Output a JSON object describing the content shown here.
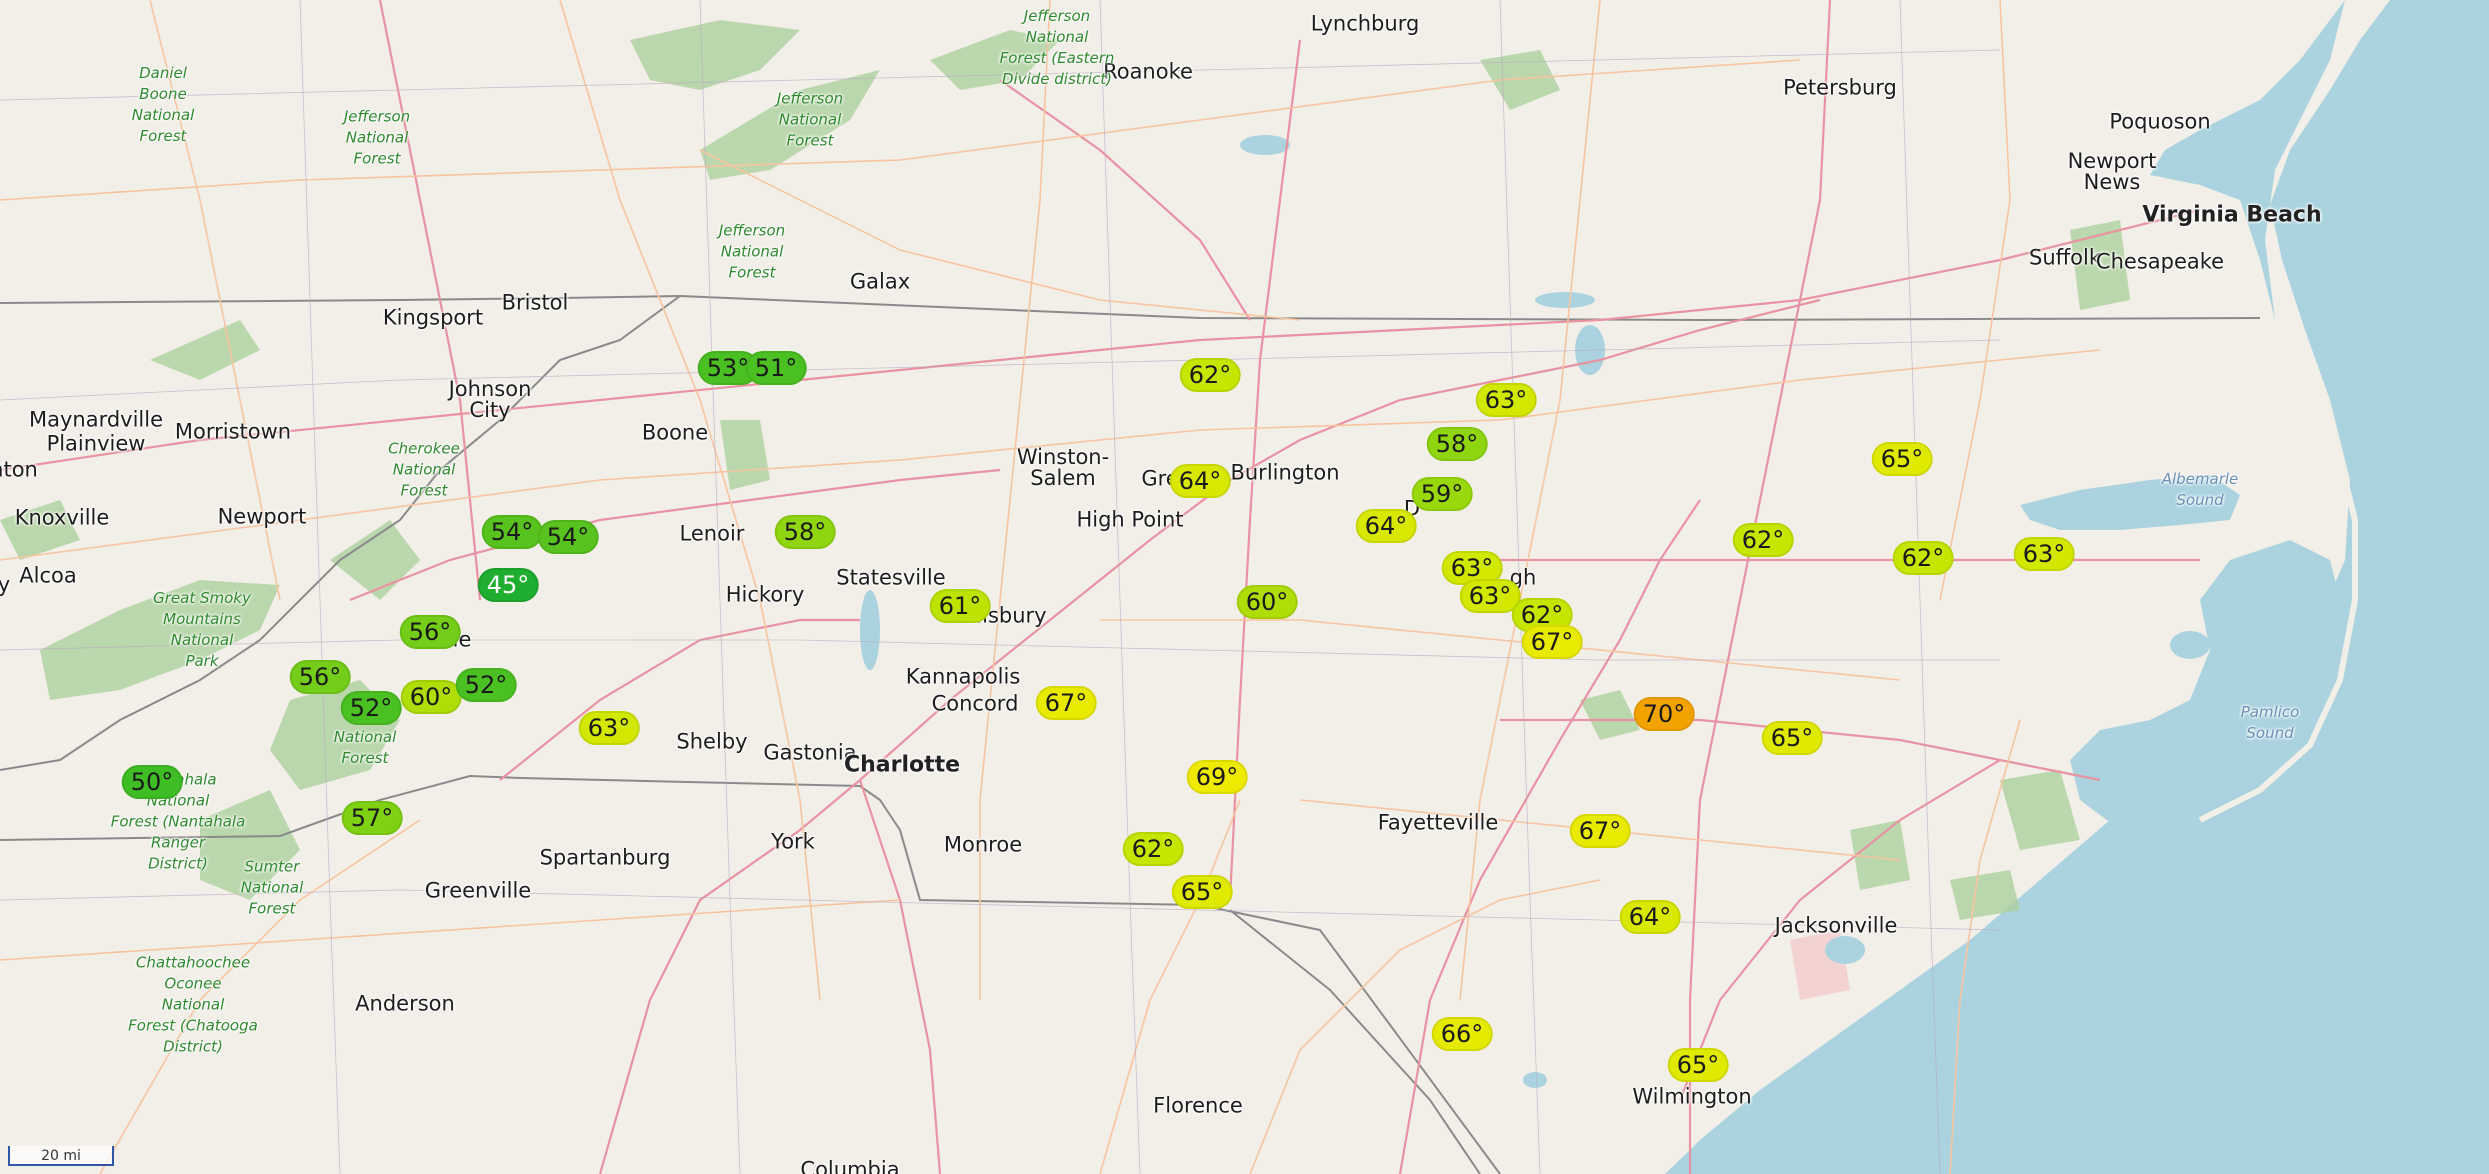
{
  "map": {
    "colors": {
      "land": "#f2efe9",
      "water": "#aad3df",
      "forest": "#add19e",
      "road_primary": "#e892a2",
      "road_secondary": "#f7c4a0",
      "state_border": "#8a8a8a"
    },
    "scale_label": "20 mi",
    "places": [
      {
        "id": "lynchburg",
        "label": "Lynchburg"
      },
      {
        "id": "roanoke",
        "label": "Roanoke"
      },
      {
        "id": "petersburg",
        "label": "Petersburg"
      },
      {
        "id": "poquoson",
        "label": "Poquoson"
      },
      {
        "id": "newport-news",
        "label": "Newport\nNews"
      },
      {
        "id": "virginia-beach",
        "label": "Virginia Beach"
      },
      {
        "id": "suffolk",
        "label": "Suffolk"
      },
      {
        "id": "chesapeake",
        "label": "Chesapeake"
      },
      {
        "id": "bristol",
        "label": "Bristol"
      },
      {
        "id": "kingsport",
        "label": "Kingsport"
      },
      {
        "id": "galax",
        "label": "Galax"
      },
      {
        "id": "johnson-city",
        "label": "Johnson\nCity"
      },
      {
        "id": "maynardville",
        "label": "Maynardville"
      },
      {
        "id": "plainview",
        "label": "Plainview"
      },
      {
        "id": "morristown",
        "label": "Morristown"
      },
      {
        "id": "boone",
        "label": "Boone"
      },
      {
        "id": "winston-salem",
        "label": "Winston-\nSalem"
      },
      {
        "id": "greensboro",
        "label": "Gre"
      },
      {
        "id": "burlington",
        "label": "Burlington"
      },
      {
        "id": "high-point",
        "label": "High Point"
      },
      {
        "id": "knoxville",
        "label": "Knoxville"
      },
      {
        "id": "newport",
        "label": "Newport"
      },
      {
        "id": "alcoa",
        "label": "Alcoa"
      },
      {
        "id": "lenoir",
        "label": "Lenoir"
      },
      {
        "id": "hickory",
        "label": "Hickory"
      },
      {
        "id": "statesville",
        "label": "Statesville"
      },
      {
        "id": "salisbury",
        "label": "alisbury"
      },
      {
        "id": "kannapolis",
        "label": "Kannapolis"
      },
      {
        "id": "concord",
        "label": "Concord"
      },
      {
        "id": "shelby",
        "label": "Shelby"
      },
      {
        "id": "gastonia",
        "label": "Gastonia"
      },
      {
        "id": "charlotte",
        "label": "Charlotte"
      },
      {
        "id": "monroe",
        "label": "Monroe"
      },
      {
        "id": "york",
        "label": "York"
      },
      {
        "id": "spartanburg",
        "label": "Spartanburg"
      },
      {
        "id": "greenville",
        "label": "Greenville"
      },
      {
        "id": "anderson",
        "label": "Anderson"
      },
      {
        "id": "fayetteville",
        "label": "Fayetteville"
      },
      {
        "id": "florence",
        "label": "Florence"
      },
      {
        "id": "columbia",
        "label": "Columbia"
      },
      {
        "id": "wilmington",
        "label": "Wilmington"
      },
      {
        "id": "jacksonville",
        "label": "Jacksonville"
      },
      {
        "id": "durham",
        "label": "D"
      },
      {
        "id": "raleigh",
        "label": "gh"
      },
      {
        "id": "ville",
        "label": "ville"
      },
      {
        "id": "daniel-boone",
        "label": "Daniel\nBoone\nNational\nForest"
      },
      {
        "id": "jefferson-nf-1",
        "label": "Jefferson\nNational\nForest"
      },
      {
        "id": "jefferson-nf-2",
        "label": "Jefferson\nNational\nForest"
      },
      {
        "id": "jefferson-nf-3",
        "label": "Jefferson\nNational\nForest"
      },
      {
        "id": "jefferson-eastern",
        "label": "Jefferson\nNational\nForest (Eastern\nDivide district)"
      },
      {
        "id": "cherokee-nf",
        "label": "Cherokee\nNational\nForest"
      },
      {
        "id": "great-smoky",
        "label": "Great Smoky\nMountains\nNational\nPark"
      },
      {
        "id": "nantahala",
        "label": "Nantahala\nNational\nForest (Nantahala\nRanger\nDistrict)"
      },
      {
        "id": "national-forest",
        "label": "National\nForest"
      },
      {
        "id": "sumter",
        "label": "Sumter\nNational\nForest"
      },
      {
        "id": "chattahoochee",
        "label": "Chattahoochee\nOconee\nNational\nForest (Chatooga\nDistrict)"
      },
      {
        "id": "albemarle",
        "label": "Albemarle\nSound"
      },
      {
        "id": "pamlico",
        "label": "Pamlico\nSound"
      },
      {
        "id": "tn-left",
        "label": "nton"
      },
      {
        "id": "tn-y",
        "label": "y"
      }
    ],
    "temperatures": [
      {
        "id": "t1",
        "label": "53°",
        "temp": 53,
        "color": "#4bc022"
      },
      {
        "id": "t2",
        "label": "51°",
        "temp": 51,
        "color": "#4bc022"
      },
      {
        "id": "t3",
        "label": "62°",
        "temp": 62,
        "color": "#c6e600"
      },
      {
        "id": "t4",
        "label": "63°",
        "temp": 63,
        "color": "#d2e800"
      },
      {
        "id": "t5",
        "label": "58°",
        "temp": 58,
        "color": "#8fd610"
      },
      {
        "id": "t6",
        "label": "65°",
        "temp": 65,
        "color": "#e0ea00"
      },
      {
        "id": "t7",
        "label": "64°",
        "temp": 64,
        "color": "#d8e800"
      },
      {
        "id": "t8",
        "label": "59°",
        "temp": 59,
        "color": "#99d90c"
      },
      {
        "id": "t9",
        "label": "64°",
        "temp": 64,
        "color": "#d8e800"
      },
      {
        "id": "t10",
        "label": "54°",
        "temp": 54,
        "color": "#58c31e"
      },
      {
        "id": "t11",
        "label": "54°",
        "temp": 54,
        "color": "#58c31e"
      },
      {
        "id": "t12",
        "label": "58°",
        "temp": 58,
        "color": "#8fd610"
      },
      {
        "id": "t13",
        "label": "62°",
        "temp": 62,
        "color": "#c6e600"
      },
      {
        "id": "t14",
        "label": "62°",
        "temp": 62,
        "color": "#c6e600"
      },
      {
        "id": "t15",
        "label": "63°",
        "temp": 63,
        "color": "#d2e800"
      },
      {
        "id": "t16",
        "label": "45°",
        "temp": 45,
        "color": "#1fae2f"
      },
      {
        "id": "t17",
        "label": "63°",
        "temp": 63,
        "color": "#d2e800"
      },
      {
        "id": "t18",
        "label": "63°",
        "temp": 63,
        "color": "#d2e800"
      },
      {
        "id": "t19",
        "label": "61°",
        "temp": 61,
        "color": "#bce400"
      },
      {
        "id": "t20",
        "label": "60°",
        "temp": 60,
        "color": "#aedd08"
      },
      {
        "id": "t21",
        "label": "62°",
        "temp": 62,
        "color": "#c6e600"
      },
      {
        "id": "t22",
        "label": "56°",
        "temp": 56,
        "color": "#74cd18"
      },
      {
        "id": "t23",
        "label": "67°",
        "temp": 67,
        "color": "#e8ea00"
      },
      {
        "id": "t24",
        "label": "56°",
        "temp": 56,
        "color": "#74cd18"
      },
      {
        "id": "t25",
        "label": "52°",
        "temp": 52,
        "color": "#4bc022"
      },
      {
        "id": "t26",
        "label": "60°",
        "temp": 60,
        "color": "#aedd08"
      },
      {
        "id": "t27",
        "label": "52°",
        "temp": 52,
        "color": "#4bc022"
      },
      {
        "id": "t28",
        "label": "67°",
        "temp": 67,
        "color": "#e8ea00"
      },
      {
        "id": "t29",
        "label": "70°",
        "temp": 70,
        "color": "#f2a300"
      },
      {
        "id": "t30",
        "label": "63°",
        "temp": 63,
        "color": "#d2e800"
      },
      {
        "id": "t31",
        "label": "65°",
        "temp": 65,
        "color": "#e0ea00"
      },
      {
        "id": "t32",
        "label": "50°",
        "temp": 50,
        "color": "#3fbd25"
      },
      {
        "id": "t33",
        "label": "69°",
        "temp": 69,
        "color": "#eeea00"
      },
      {
        "id": "t34",
        "label": "57°",
        "temp": 57,
        "color": "#7fd114"
      },
      {
        "id": "t35",
        "label": "67°",
        "temp": 67,
        "color": "#e8ea00"
      },
      {
        "id": "t36",
        "label": "62°",
        "temp": 62,
        "color": "#c6e600"
      },
      {
        "id": "t37",
        "label": "65°",
        "temp": 65,
        "color": "#e0ea00"
      },
      {
        "id": "t38",
        "label": "64°",
        "temp": 64,
        "color": "#d8e800"
      },
      {
        "id": "t39",
        "label": "66°",
        "temp": 66,
        "color": "#e4ea00"
      },
      {
        "id": "t40",
        "label": "65°",
        "temp": 65,
        "color": "#e0ea00"
      }
    ]
  }
}
